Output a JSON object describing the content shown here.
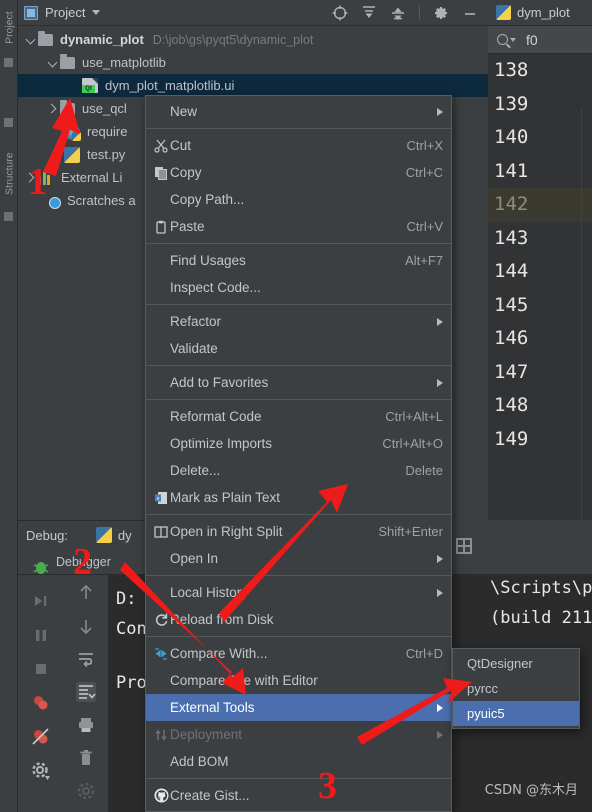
{
  "window": {
    "vertical_tabs": [
      "Project",
      "Structure"
    ]
  },
  "project_panel": {
    "title": "Project",
    "title_icon": "project-module-icon",
    "dropdown_icon": "chevron-down-icon",
    "toolbar_icons": [
      "locate-target-icon",
      "expand-all-icon",
      "collapse-all-icon",
      "gear-icon",
      "minimize-icon"
    ],
    "tree": [
      {
        "label": "dynamic_plot",
        "path": "D:\\job\\gs\\pyqt5\\dynamic_plot",
        "icon": "folder-icon",
        "twisty": "chevron-down-icon",
        "indent": 0,
        "bold": true,
        "selected": false
      },
      {
        "label": "use_matplotlib",
        "path": "",
        "icon": "folder-icon",
        "twisty": "chevron-down-icon",
        "indent": 1,
        "bold": false,
        "selected": false
      },
      {
        "label": "dym_plot_matplotlib.ui",
        "path": "",
        "icon": "qt-ui-file-icon",
        "twisty": "",
        "indent": 2,
        "bold": false,
        "selected": true
      },
      {
        "label": "use_qcl",
        "path": "",
        "icon": "folder-icon",
        "twisty": "chevron-right-icon",
        "indent": 1,
        "bold": false,
        "selected": false
      },
      {
        "label": "require",
        "path": "",
        "icon": "package-icon",
        "twisty": "",
        "indent": 1,
        "bold": false,
        "selected": false
      },
      {
        "label": "test.py",
        "path": "",
        "icon": "python-file-icon",
        "twisty": "",
        "indent": 1,
        "bold": false,
        "selected": false
      },
      {
        "label": "External Li",
        "path": "",
        "icon": "external-libraries-icon",
        "twisty": "chevron-right-icon",
        "indent": 0,
        "bold": false,
        "selected": false
      },
      {
        "label": "Scratches a",
        "path": "",
        "icon": "scratches-icon",
        "twisty": "",
        "indent": 0,
        "bold": false,
        "selected": false
      }
    ]
  },
  "editor": {
    "tab_label": "dym_plot",
    "tab_icon": "python-file-icon",
    "search_icon": "search-icon",
    "search_value": "f0",
    "line_numbers": [
      "138",
      "139",
      "140",
      "141",
      "142",
      "143",
      "144",
      "145",
      "146",
      "147",
      "148",
      "149"
    ],
    "current_line": "142",
    "fold_lines": [
      "139",
      "141",
      "142",
      "144",
      "148"
    ]
  },
  "debug_panel": {
    "title_label": "Debug:",
    "title_config": "dy",
    "config_icon": "python-file-icon",
    "tabs": [
      "Debugger"
    ],
    "side_icons": [
      "debug-bug-icon",
      "resume-icon",
      "pause-icon",
      "stop-icon",
      "view-breakpoints-icon",
      "mute-breakpoints-icon",
      "settings-icon"
    ],
    "side_icons2": [
      "step-up-icon",
      "step-down-icon",
      "restore-layout-icon",
      "scroll-to-end-icon",
      "print-icon",
      "trash-icon",
      "settings2-icon"
    ],
    "console_lines": [
      "D: ",
      "Con",
      "",
      "Pro"
    ],
    "console_right_lines": [
      "\\Scripts\\py",
      "(build 211"
    ],
    "grid_icon": "grid-icon"
  },
  "context_menu": {
    "items": [
      {
        "label": "New",
        "mnemonic": "",
        "shortcut": "",
        "icon": "",
        "submenu": true,
        "highlighted": false,
        "disabled": false,
        "separator_after": true
      },
      {
        "label": "Cut",
        "mnemonic": "t",
        "shortcut": "Ctrl+X",
        "icon": "scissors-icon",
        "submenu": false,
        "highlighted": false,
        "disabled": false,
        "separator_after": false
      },
      {
        "label": "Copy",
        "mnemonic": "C",
        "shortcut": "Ctrl+C",
        "icon": "copy-icon",
        "submenu": false,
        "highlighted": false,
        "disabled": false,
        "separator_after": false
      },
      {
        "label": "Copy Path...",
        "mnemonic": "",
        "shortcut": "",
        "icon": "",
        "submenu": false,
        "highlighted": false,
        "disabled": false,
        "separator_after": false
      },
      {
        "label": "Paste",
        "mnemonic": "P",
        "shortcut": "Ctrl+V",
        "icon": "clipboard-icon",
        "submenu": false,
        "highlighted": false,
        "disabled": false,
        "separator_after": true
      },
      {
        "label": "Find Usages",
        "mnemonic": "U",
        "shortcut": "Alt+F7",
        "icon": "",
        "submenu": false,
        "highlighted": false,
        "disabled": false,
        "separator_after": false
      },
      {
        "label": "Inspect Code...",
        "mnemonic": "I",
        "shortcut": "",
        "icon": "",
        "submenu": false,
        "highlighted": false,
        "disabled": false,
        "separator_after": true
      },
      {
        "label": "Refactor",
        "mnemonic": "R",
        "shortcut": "",
        "icon": "",
        "submenu": true,
        "highlighted": false,
        "disabled": false,
        "separator_after": false
      },
      {
        "label": "Validate",
        "mnemonic": "V",
        "shortcut": "",
        "icon": "",
        "submenu": false,
        "highlighted": false,
        "disabled": false,
        "separator_after": true
      },
      {
        "label": "Add to Favorites",
        "mnemonic": "F",
        "shortcut": "",
        "icon": "",
        "submenu": true,
        "highlighted": false,
        "disabled": false,
        "separator_after": true
      },
      {
        "label": "Reformat Code",
        "mnemonic": "R",
        "shortcut": "Ctrl+Alt+L",
        "icon": "",
        "submenu": false,
        "highlighted": false,
        "disabled": false,
        "separator_after": false
      },
      {
        "label": "Optimize Imports",
        "mnemonic": "z",
        "shortcut": "Ctrl+Alt+O",
        "icon": "",
        "submenu": false,
        "highlighted": false,
        "disabled": false,
        "separator_after": false
      },
      {
        "label": "Delete...",
        "mnemonic": "D",
        "shortcut": "Delete",
        "icon": "",
        "submenu": false,
        "highlighted": false,
        "disabled": false,
        "separator_after": false
      },
      {
        "label": "Mark as Plain Text",
        "mnemonic": "",
        "shortcut": "",
        "icon": "plain-text-icon",
        "submenu": false,
        "highlighted": false,
        "disabled": false,
        "separator_after": true
      },
      {
        "label": "Open in Right Split",
        "mnemonic": "",
        "shortcut": "Shift+Enter",
        "icon": "split-icon",
        "submenu": false,
        "highlighted": false,
        "disabled": false,
        "separator_after": false
      },
      {
        "label": "Open In",
        "mnemonic": "",
        "shortcut": "",
        "icon": "",
        "submenu": true,
        "highlighted": false,
        "disabled": false,
        "separator_after": true
      },
      {
        "label": "Local History",
        "mnemonic": "H",
        "shortcut": "",
        "icon": "",
        "submenu": true,
        "highlighted": false,
        "disabled": false,
        "separator_after": false
      },
      {
        "label": "Reload from Disk",
        "mnemonic": "",
        "shortcut": "",
        "icon": "reload-icon",
        "submenu": false,
        "highlighted": false,
        "disabled": false,
        "separator_after": true
      },
      {
        "label": "Compare With...",
        "mnemonic": "",
        "shortcut": "Ctrl+D",
        "icon": "compare-icon",
        "submenu": false,
        "highlighted": false,
        "disabled": false,
        "separator_after": false
      },
      {
        "label": "Compare File with Editor",
        "mnemonic": "p",
        "shortcut": "",
        "icon": "",
        "submenu": false,
        "highlighted": false,
        "disabled": false,
        "separator_after": false
      },
      {
        "label": "External Tools",
        "mnemonic": "",
        "shortcut": "",
        "icon": "",
        "submenu": true,
        "highlighted": true,
        "disabled": false,
        "separator_after": false
      },
      {
        "label": "Deployment",
        "mnemonic": "",
        "shortcut": "",
        "icon": "deployment-icon",
        "submenu": true,
        "highlighted": false,
        "disabled": true,
        "separator_after": false
      },
      {
        "label": "Add BOM",
        "mnemonic": "",
        "shortcut": "",
        "icon": "",
        "submenu": false,
        "highlighted": false,
        "disabled": false,
        "separator_after": true
      },
      {
        "label": "Create Gist...",
        "mnemonic": "",
        "shortcut": "",
        "icon": "github-icon",
        "submenu": false,
        "highlighted": false,
        "disabled": false,
        "separator_after": false
      }
    ]
  },
  "submenu": {
    "items": [
      {
        "label": "QtDesigner",
        "highlighted": false
      },
      {
        "label": "pyrcc",
        "highlighted": false
      },
      {
        "label": "pyuic5",
        "highlighted": true
      }
    ]
  },
  "annotations": {
    "numbers": [
      "1",
      "2",
      "3"
    ],
    "color": "#ef1b1b"
  },
  "watermark": {
    "text": "CSDN @东木月"
  }
}
